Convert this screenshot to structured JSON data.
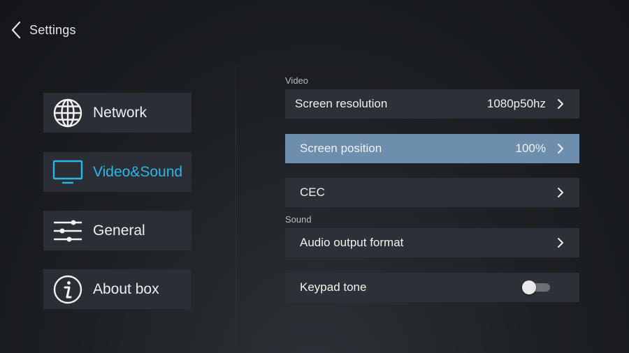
{
  "header": {
    "title": "Settings",
    "back_icon": "chevron-left-icon"
  },
  "sidebar": {
    "items": [
      {
        "label": "Network",
        "icon": "globe-icon",
        "active": false
      },
      {
        "label": "Video&Sound",
        "icon": "monitor-icon",
        "active": true
      },
      {
        "label": "General",
        "icon": "sliders-icon",
        "active": false
      },
      {
        "label": "About box",
        "icon": "info-icon",
        "active": false
      }
    ]
  },
  "main": {
    "video_section": {
      "label": "Video"
    },
    "sound_section": {
      "label": "Sound"
    },
    "rows": {
      "screen_resolution": {
        "label": "Screen resolution",
        "value": "1080p50hz"
      },
      "screen_position": {
        "label": "Screen position",
        "value": "100%",
        "selected": true
      },
      "cec": {
        "label": "CEC"
      },
      "audio_output_format": {
        "label": "Audio output format"
      },
      "keypad_tone": {
        "label": "Keypad tone",
        "enabled": false
      }
    }
  },
  "colors": {
    "accent": "#2bb6ea",
    "selected_row": "#6e8ead",
    "item_bg": "#2b2f35",
    "background": "#1c1f23"
  }
}
